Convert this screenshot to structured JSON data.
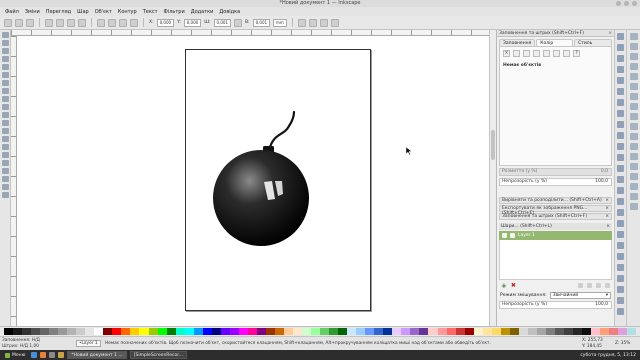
{
  "window": {
    "title": "*Новий документ 1 — Inkscape"
  },
  "menu": [
    "Файл",
    "Зміни",
    "Перегляд",
    "Шар",
    "Об'єкт",
    "Контур",
    "Текст",
    "Фільтри",
    "Додатки",
    "Довідка"
  ],
  "toolbar": {
    "x_label": "X:",
    "x_value": "0,000",
    "y_label": "Y:",
    "y_value": "0,000",
    "w_label": "Ш:",
    "w_value": "0,001",
    "h_label": "В:",
    "h_value": "0,001",
    "unit": "mm"
  },
  "fill_stroke": {
    "title": "Заповнення та штрих (Shift+Ctrl+F)",
    "tabs": [
      "Заповнення",
      "Колір штриха",
      "Стиль штриха"
    ],
    "active_tab": 1,
    "no_objects": "Немає об'єктів",
    "unknown_label": "?",
    "blur_label": "Розмиття (у %)",
    "blur_value": "0,0",
    "opacity_label": "Непрозорість (у %)",
    "opacity_value": "100,0"
  },
  "collapsed_panels": [
    "Вирівняти та розподілити... (Shift+Ctrl+A)",
    "Експортувати як зображення PNG... (Shift+Ctrl+E)",
    "Заповнення та штрих (Shift+Ctrl+F)"
  ],
  "layers": {
    "title": "Шари... (Shift+Ctrl+L)",
    "items": [
      {
        "name": "Layer 1"
      }
    ],
    "blend_label": "Режим змішування:",
    "blend_value": "Звичайний",
    "opacity_label": "Непрозорість (у %)",
    "opacity_value": "100,0"
  },
  "palette": [
    "#000000",
    "#1a1a1a",
    "#333333",
    "#4d4d4d",
    "#666666",
    "#808080",
    "#999999",
    "#b3b3b3",
    "#cccccc",
    "#e6e6e6",
    "#ffffff",
    "#800000",
    "#ff0000",
    "#ff6600",
    "#ffcc00",
    "#ffff00",
    "#99cc00",
    "#00ff00",
    "#008000",
    "#00ffcc",
    "#00ffff",
    "#0099ff",
    "#0000ff",
    "#000080",
    "#6600ff",
    "#9900ff",
    "#ff00ff",
    "#ff0099",
    "#800080",
    "#993300",
    "#cc6600",
    "#ffcc99",
    "#ffe6cc",
    "#ccffcc",
    "#99ff99",
    "#66cc66",
    "#339933",
    "#006600",
    "#cce6ff",
    "#99ccff",
    "#6699ff",
    "#3366cc",
    "#003399",
    "#e6ccff",
    "#cc99ff",
    "#9966cc",
    "#663399",
    "#ffcccc",
    "#ff9999",
    "#ff6666",
    "#cc3333",
    "#990000",
    "#fff2cc",
    "#ffe599",
    "#ffd966",
    "#bf9000",
    "#7f6000",
    "#d9d9d9",
    "#bfbfbf",
    "#a6a6a6",
    "#7f7f7f",
    "#595959",
    "#404040",
    "#262626",
    "#0d0d0d",
    "#ffc0cb",
    "#ffa07a",
    "#f08080",
    "#dda0dd",
    "#b0e0e6"
  ],
  "status": {
    "fill_label": "Заповнення:",
    "fill_value": "Н/Д",
    "stroke_label": "Штрих:",
    "stroke_value": "Н/Д",
    "stroke_width": "1,00",
    "layer_name": "•Layer 1",
    "message": "Немає позначених об'єктів. Щоб позначити об'єкт, скористайтеся клацанням, Shift+клацанням, Alt+прокручуванням коліщатка миші над об'єктами або обведіть об'єкт.",
    "x_coord": "X: 255,73",
    "y_coord": "Y: 184,45",
    "zoom_label": "Z:",
    "zoom_value": "35%"
  },
  "taskbar": {
    "menu_label": "Меню",
    "apps": [
      "*Новий документ 1 ...",
      "[SimpleScreenRecor..."
    ],
    "clock": "субота грудня, 5, 13:12"
  }
}
